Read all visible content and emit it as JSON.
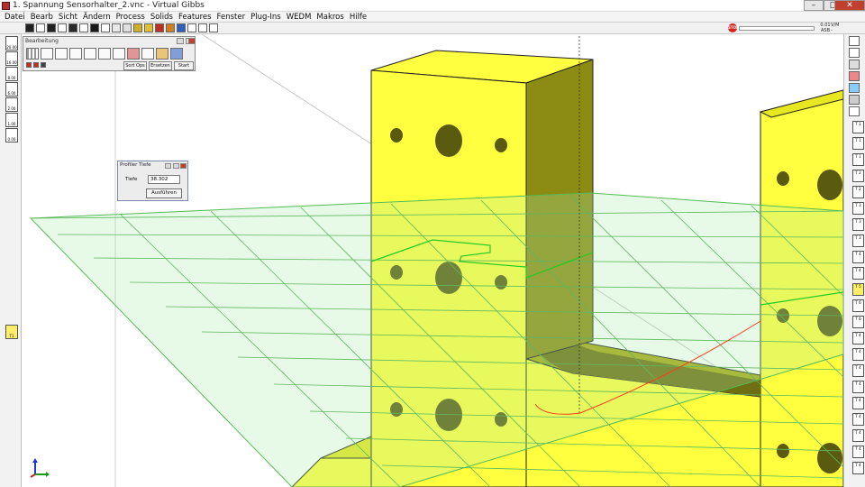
{
  "window": {
    "title": "1. Spannung Sensorhalter_2.vnc - Virtual Gibbs",
    "min_label": "–",
    "max_label": "□",
    "close_label": "✕"
  },
  "menu": {
    "items": [
      "Datei",
      "Bearb",
      "Sicht",
      "Ändern",
      "Process",
      "Solids",
      "Features",
      "Fenster",
      "Plug-Ins",
      "WEDM",
      "Makros",
      "Hilfe"
    ]
  },
  "toolbar": {
    "stop_label": "STOP",
    "speed_top": "0.01",
    "speed_bottom": "ASB",
    "speed_right_top": "V/M",
    "speed_right_bottom": "-"
  },
  "palette": {
    "title": "Bearbeitung",
    "buttons": [
      "Sort Ops",
      "Ersetzen",
      "Start"
    ]
  },
  "dialog": {
    "title": "Profiler Tiefe",
    "field_label": "Tiefe",
    "field_value": "38.302",
    "submit_label": "Ausführen"
  },
  "left_tools": [
    {
      "label": "20.00"
    },
    {
      "label": "16.00"
    },
    {
      "label": "8.00"
    },
    {
      "label": "6.00"
    },
    {
      "label": "2.00"
    },
    {
      "label": "1.00"
    },
    {
      "label": "0.00"
    }
  ],
  "left_tools_lower": [
    {
      "label": "T1"
    }
  ],
  "right_tiles": [
    "T 1",
    "T 1",
    "T 1",
    "T 2",
    "T 2",
    "T 3",
    "T 3",
    "T 3",
    "T 4",
    "T 4",
    "T 5",
    "T 6",
    "T 6",
    "T 4",
    "T 4",
    "T 4",
    "T 4",
    "T 4",
    "T 4",
    "T 4",
    "T 4",
    "T 4"
  ],
  "colors": {
    "part": "#ffff3c",
    "part_shade": "#c2c21a",
    "part_dark": "#7c7c14",
    "grid": "#55bb55",
    "toolpath": "#ff3b1a",
    "background": "#ffffff"
  }
}
